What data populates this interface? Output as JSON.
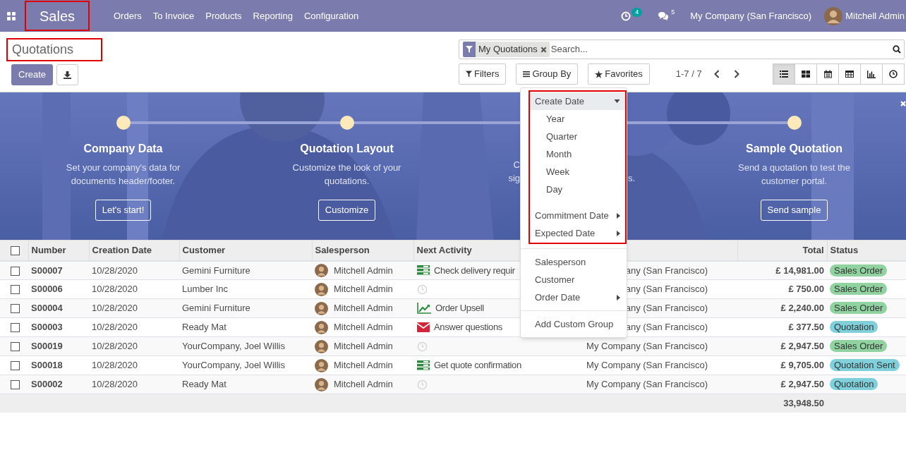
{
  "navbar": {
    "app": "Sales",
    "app_highlighted": true,
    "menu": [
      "Orders",
      "To Invoice",
      "Products",
      "Reporting",
      "Configuration"
    ],
    "activity_count": "4",
    "message_count": "5",
    "company": "My Company (San Francisco)",
    "user": "Mitchell Admin"
  },
  "control_panel": {
    "title": "Quotations",
    "title_highlighted": true,
    "create": "Create",
    "search": {
      "facet": "My Quotations",
      "placeholder": "Search..."
    },
    "filters": "Filters",
    "group_by": "Group By",
    "favorites": "Favorites",
    "pager": "1-7 / 7",
    "views": [
      {
        "kind": "list",
        "selected": true
      },
      {
        "kind": "kanban",
        "selected": false
      },
      {
        "kind": "calendar",
        "selected": false
      },
      {
        "kind": "pivot",
        "selected": false
      },
      {
        "kind": "graph",
        "selected": false
      },
      {
        "kind": "activity",
        "selected": false
      }
    ]
  },
  "onboarding": {
    "steps": [
      {
        "kind": "full",
        "title": "Company Data",
        "description": "Set your company's data for documents header/footer.",
        "button": "Let's start!"
      },
      {
        "kind": "full",
        "title": "Quotation Layout",
        "description": "Customize the look of your quotations.",
        "button": "Customize"
      },
      {
        "kind": "covered",
        "left_lines": [
          "C",
          "sig"
        ],
        "right_lines": [
          "s."
        ]
      },
      {
        "kind": "full",
        "title": "Sample Quotation",
        "description": "Send a quotation to test the customer portal.",
        "button": "Send sample"
      }
    ]
  },
  "group_by_menu": {
    "date_section_highlighted": true,
    "date_groups": [
      {
        "label": "Create Date",
        "expanded": true,
        "selected": true,
        "options": [
          "Year",
          "Quarter",
          "Month",
          "Week",
          "Day"
        ]
      },
      {
        "label": "Commitment Date",
        "expanded": false,
        "selected": false
      },
      {
        "label": "Expected Date",
        "expanded": false,
        "selected": false
      }
    ],
    "fields": [
      {
        "label": "Salesperson",
        "has_submenu": false
      },
      {
        "label": "Customer",
        "has_submenu": false
      },
      {
        "label": "Order Date",
        "has_submenu": true
      }
    ],
    "custom": "Add Custom Group"
  },
  "table": {
    "select_all_checked": false,
    "columns": [
      "Number",
      "Creation Date",
      "Customer",
      "Salesperson",
      "Next Activity",
      "Total",
      "Status"
    ],
    "rows": [
      {
        "checked": false,
        "number": "S00007",
        "date": "10/28/2020",
        "customer": "Gemini Furniture",
        "salesperson": "Mitchell Admin",
        "activity": {
          "kind": "todo",
          "text": "Check delivery requir"
        },
        "company": "any (San Francisco)",
        "total": "£ 14,981.00",
        "status": {
          "label": "Sales Order",
          "color": "#90d2a0"
        }
      },
      {
        "checked": false,
        "number": "S00006",
        "date": "10/28/2020",
        "customer": "Lumber Inc",
        "salesperson": "Mitchell Admin",
        "activity": {
          "kind": "none"
        },
        "company": "any (San Francisco)",
        "total": "£ 750.00",
        "status": {
          "label": "Sales Order",
          "color": "#90d2a0"
        }
      },
      {
        "checked": false,
        "number": "S00004",
        "date": "10/28/2020",
        "customer": "Gemini Furniture",
        "salesperson": "Mitchell Admin",
        "activity": {
          "kind": "upsell",
          "text": "Order Upsell"
        },
        "company": "any (San Francisco)",
        "total": "£ 2,240.00",
        "status": {
          "label": "Sales Order",
          "color": "#90d2a0"
        }
      },
      {
        "checked": false,
        "number": "S00003",
        "date": "10/28/2020",
        "customer": "Ready Mat",
        "salesperson": "Mitchell Admin",
        "activity": {
          "kind": "email",
          "text": "Answer questions"
        },
        "company": "any (San Francisco)",
        "total": "£ 377.50",
        "status": {
          "label": "Quotation",
          "color": "#80d0dc"
        }
      },
      {
        "checked": false,
        "number": "S00019",
        "date": "10/28/2020",
        "customer": "YourCompany, Joel Willis",
        "salesperson": "Mitchell Admin",
        "activity": {
          "kind": "none"
        },
        "company": "My Company (San Francisco)",
        "total": "£ 2,947.50",
        "status": {
          "label": "Sales Order",
          "color": "#90d2a0"
        }
      },
      {
        "checked": false,
        "number": "S00018",
        "date": "10/28/2020",
        "customer": "YourCompany, Joel Willis",
        "salesperson": "Mitchell Admin",
        "activity": {
          "kind": "todo",
          "text": "Get quote confirmation"
        },
        "company": "My Company (San Francisco)",
        "total": "£ 9,705.00",
        "status": {
          "label": "Quotation Sent",
          "color": "#80d0dc"
        }
      },
      {
        "checked": false,
        "number": "S00002",
        "date": "10/28/2020",
        "customer": "Ready Mat",
        "salesperson": "Mitchell Admin",
        "activity": {
          "kind": "none"
        },
        "company": "My Company (San Francisco)",
        "total": "£ 2,947.50",
        "status": {
          "label": "Quotation",
          "color": "#80d0dc"
        }
      }
    ],
    "sum": "33,948.50"
  }
}
